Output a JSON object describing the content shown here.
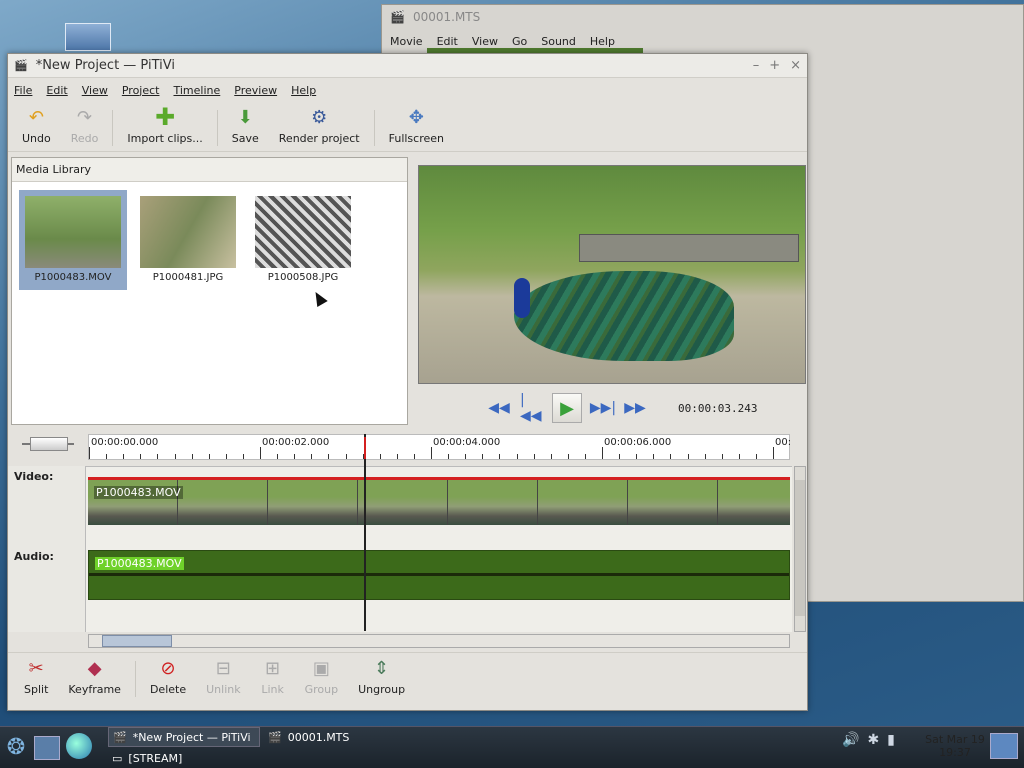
{
  "bg_window": {
    "title": "00001.MTS",
    "menu": [
      "Movie",
      "Edit",
      "View",
      "Go",
      "Sound",
      "Help"
    ]
  },
  "window": {
    "title": "*New Project — PiTiVi",
    "controls": [
      "–",
      "+",
      "×"
    ]
  },
  "menu": [
    "File",
    "Edit",
    "View",
    "Project",
    "Timeline",
    "Preview",
    "Help"
  ],
  "toolbar": [
    {
      "label": "Undo",
      "icon": "undo-arrow-icon",
      "enabled": true
    },
    {
      "label": "Redo",
      "icon": "redo-arrow-icon",
      "enabled": false
    },
    {
      "label": "Import clips...",
      "icon": "plus-icon",
      "enabled": true
    },
    {
      "label": "Save",
      "icon": "save-icon",
      "enabled": true
    },
    {
      "label": "Render project",
      "icon": "render-film-icon",
      "enabled": true
    },
    {
      "label": "Fullscreen",
      "icon": "fullscreen-icon",
      "enabled": true
    }
  ],
  "media_library": {
    "header": "Media Library",
    "items": [
      "P1000483.MOV",
      "P1000481.JPG",
      "P1000508.JPG"
    ],
    "selected": 0
  },
  "viewer": {
    "timecode": "00:00:03.243"
  },
  "timeline": {
    "ruler": [
      "00:00:00.000",
      "00:00:02.000",
      "00:00:04.000",
      "00:00:06.000",
      "00:"
    ],
    "tracks": [
      {
        "label": "Video:",
        "clip": "P1000483.MOV"
      },
      {
        "label": "Audio:",
        "clip": "P1000483.MOV"
      }
    ]
  },
  "bottom_tools": [
    {
      "label": "Split",
      "icon": "split-scissors-icon",
      "enabled": true
    },
    {
      "label": "Keyframe",
      "icon": "keyframe-icon",
      "enabled": true
    },
    {
      "label": "Delete",
      "icon": "delete-icon",
      "enabled": true
    },
    {
      "label": "Unlink",
      "icon": "unlink-icon",
      "enabled": false
    },
    {
      "label": "Link",
      "icon": "link-icon",
      "enabled": false
    },
    {
      "label": "Group",
      "icon": "group-icon",
      "enabled": false
    },
    {
      "label": "Ungroup",
      "icon": "ungroup-icon",
      "enabled": true
    }
  ],
  "taskbar": {
    "tasks": [
      "*New Project — PiTiVi",
      "00001.MTS",
      "[STREAM]"
    ],
    "clock": {
      "day": "Sat Mar 19",
      "time": "19:37"
    }
  }
}
